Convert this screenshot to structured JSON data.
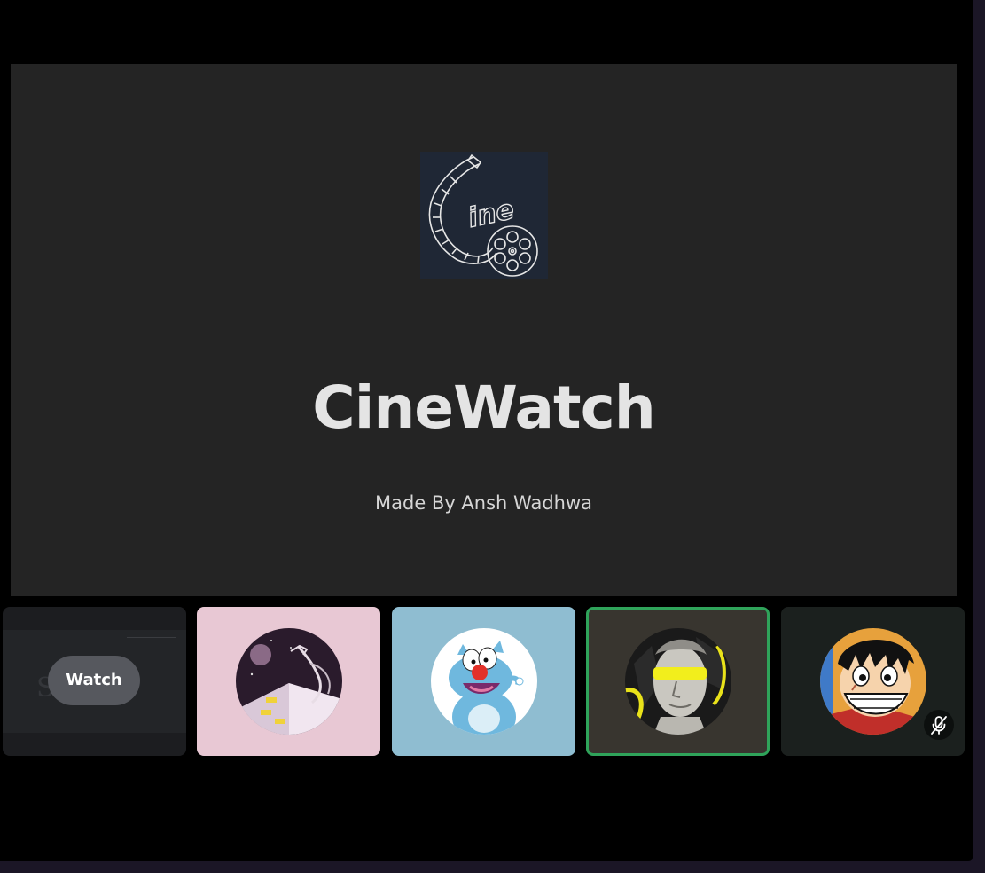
{
  "presentation": {
    "logo_icon": "cine-film-reel-logo",
    "logo_text": "ine",
    "title": "CineWatch",
    "subtitle": "Made By Ansh Wadhwa"
  },
  "participants": [
    {
      "kind": "screen-share",
      "action_label": "Watch",
      "background": "#1c1d20"
    },
    {
      "kind": "avatar",
      "avatar_icon": "sketch-hand-building-avatar",
      "background": "#e8c8d4"
    },
    {
      "kind": "avatar",
      "avatar_icon": "oggy-cat-avatar",
      "background": "#8fbdd1"
    },
    {
      "kind": "avatar",
      "avatar_icon": "statue-yellow-glasses-avatar",
      "background": "#38352f",
      "speaking": true,
      "speaking_color": "#2fa35a"
    },
    {
      "kind": "avatar",
      "avatar_icon": "luffy-avatar",
      "background": "#1b201e",
      "muted": true,
      "status_icon": "mic-off-icon"
    }
  ],
  "colors": {
    "stage": "#000000",
    "presentation": "#242424",
    "title": "#e4e4e4",
    "accent_speaking": "#2fa35a"
  }
}
